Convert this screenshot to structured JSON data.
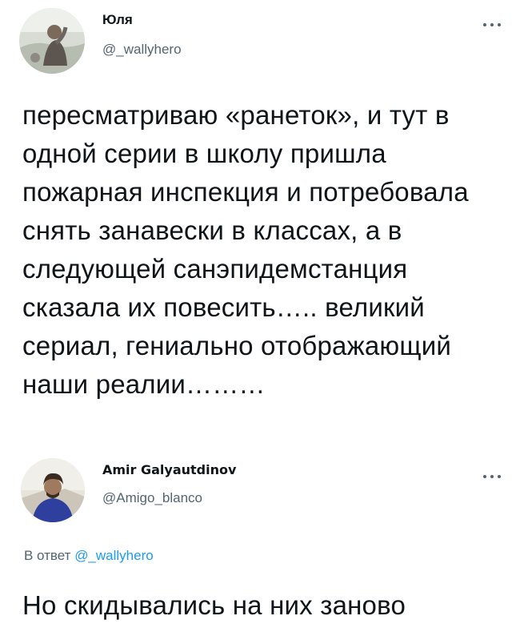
{
  "tweets": [
    {
      "author_name": "Юля",
      "author_handle": "@_wallyhero",
      "text": "пересматриваю «ранеток», и тут в одной серии в школу пришла пожарная инспекция и потребовала снять занавески в классах, а в следующей санэпидемстанция сказала их повесить….. великий сериал, гениально отображающий наши реалии………"
    },
    {
      "author_name": "Amir Galyautdinov",
      "author_handle": "@Amigo_blanco",
      "reply_prefix": "В ответ",
      "reply_handle": "@_wallyhero",
      "text": "Но скидывались на них заново"
    }
  ],
  "icons": {
    "more": "more-dots-icon"
  },
  "colors": {
    "text": "#0f1419",
    "secondary": "#536471",
    "link": "#1d9bf0"
  }
}
